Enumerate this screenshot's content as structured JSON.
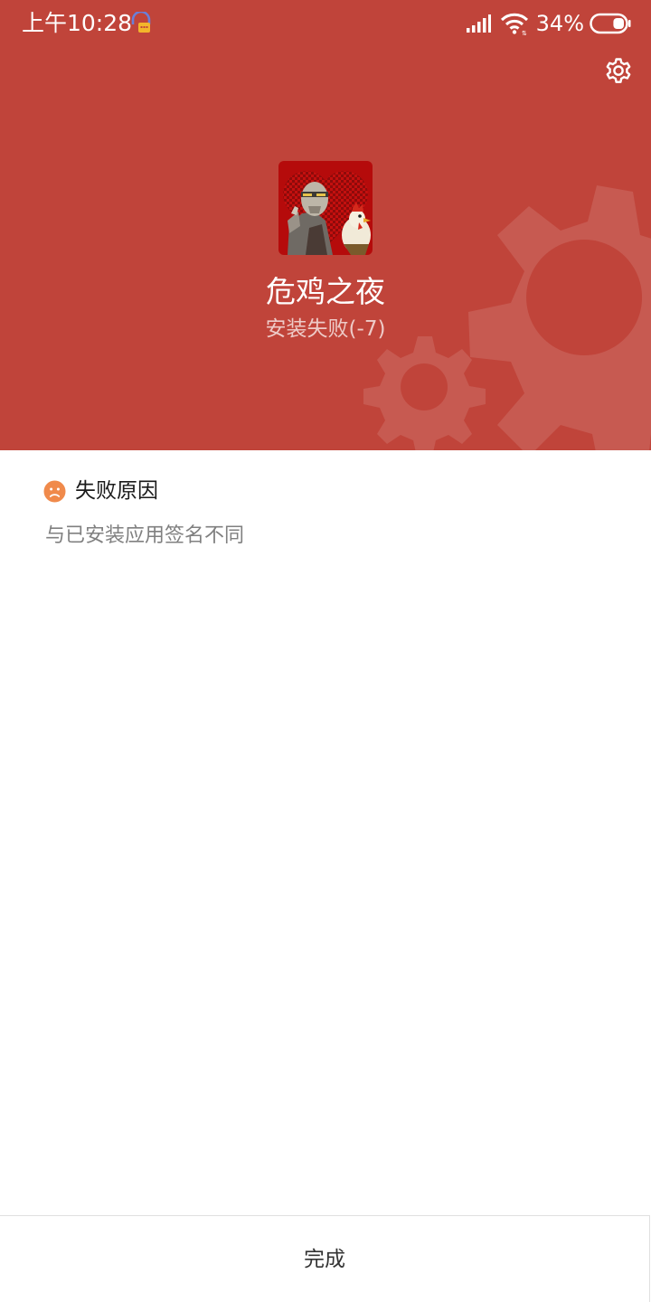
{
  "status_bar": {
    "time": "上午10:28",
    "battery_percent": "34%",
    "battery_level": 0.34,
    "icons": [
      "notification-app-icon",
      "signal-icon",
      "wifi-icon",
      "battery-icon"
    ]
  },
  "header": {
    "background_color": "#c0443a",
    "settings_icon": "gear-icon",
    "app_icon": "game-app-icon",
    "app_name": "危鸡之夜",
    "install_status": "安装失败(-7)"
  },
  "failure": {
    "icon": "sad-face-icon",
    "icon_color": "#f08a4b",
    "title": "失败原因",
    "reason": "与已安装应用签名不同"
  },
  "footer": {
    "done_label": "完成"
  }
}
